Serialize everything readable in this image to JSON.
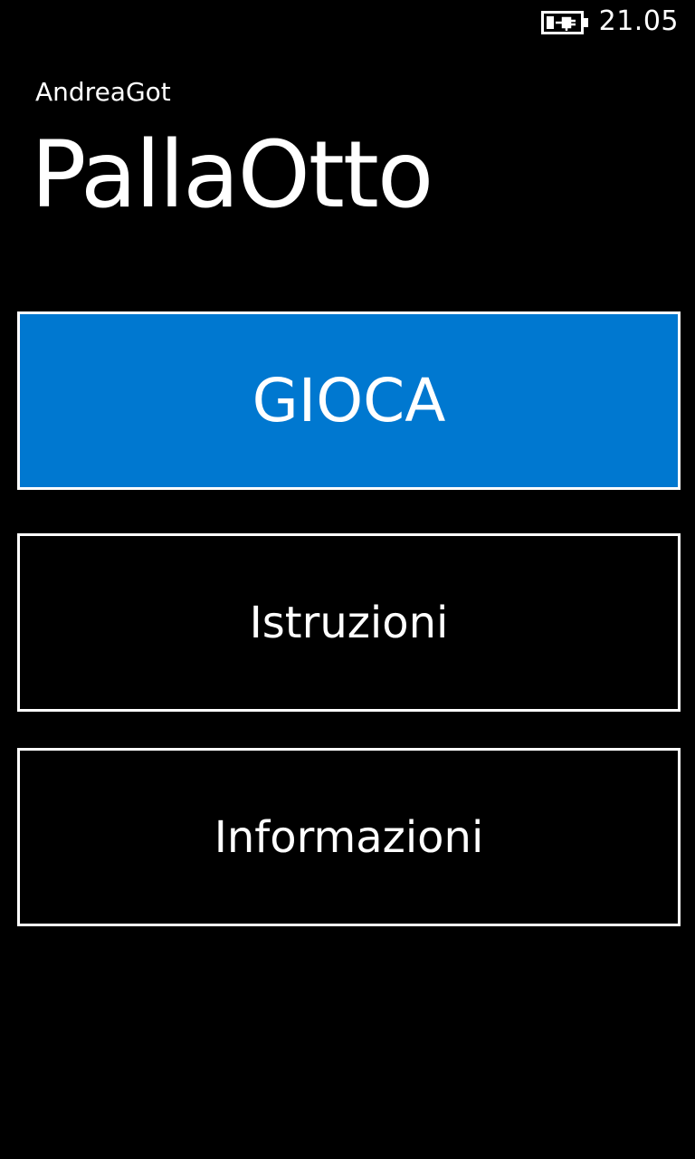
{
  "status_bar": {
    "battery_icon": "battery-charging-icon",
    "time": "21.05"
  },
  "header": {
    "owner": "AndreaGot",
    "title": "PallaOtto"
  },
  "menu": {
    "play_label": "GIOCA",
    "instructions_label": "Istruzioni",
    "info_label": "Informazioni"
  },
  "colors": {
    "background": "#000000",
    "accent": "#0078d0",
    "foreground": "#ffffff"
  }
}
